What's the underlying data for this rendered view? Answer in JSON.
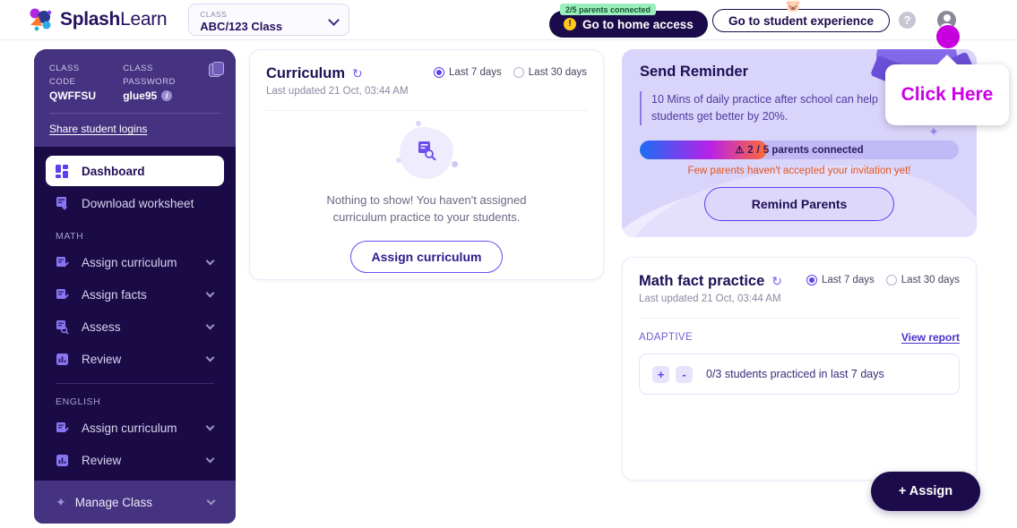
{
  "header": {
    "brand_bold": "Splash",
    "brand_light": "Learn",
    "class_selector": {
      "label": "CLASS",
      "value": "ABC/123 Class",
      "chevron_icon": "chevron-down-icon"
    },
    "parents_badge": "2/5 parents connected",
    "home_access_button": "Go to home access",
    "warning_icon": "!",
    "student_experience_button": "Go to student experience",
    "pig_icon": "🐷",
    "help_icon": "?",
    "avatar_icon": "user-avatar"
  },
  "sidebar": {
    "class_code_label": "CLASS CODE",
    "class_code_value": "QWFFSU",
    "class_password_label": "CLASS PASSWORD",
    "class_password_value": "glue95",
    "info_icon": "i",
    "copy_icon": "copy-icon",
    "share_link": "Share student logins",
    "primary_items": [
      {
        "label": "Dashboard",
        "icon": "dashboard-icon",
        "active": true
      },
      {
        "label": "Download worksheet",
        "icon": "download-worksheet-icon",
        "active": false
      }
    ],
    "math_label": "MATH",
    "math_items": [
      {
        "label": "Assign curriculum",
        "icon": "assign-icon"
      },
      {
        "label": "Assign facts",
        "icon": "assign-icon"
      },
      {
        "label": "Assess",
        "icon": "assess-icon"
      },
      {
        "label": "Review",
        "icon": "review-icon"
      }
    ],
    "english_label": "ENGLISH",
    "english_items": [
      {
        "label": "Assign curriculum",
        "icon": "assign-icon"
      },
      {
        "label": "Review",
        "icon": "review-icon"
      }
    ],
    "manage_class": "Manage Class",
    "manage_class_icon": "gear-icon"
  },
  "curriculum": {
    "title": "Curriculum",
    "refresh_icon": "refresh-icon",
    "last_updated": "Last updated 21 Oct, 03:44 AM",
    "range_options": [
      {
        "label": "Last 7 days",
        "selected": true
      },
      {
        "label": "Last 30 days",
        "selected": false
      }
    ],
    "empty_icon": "document-search-icon",
    "empty_line1": "Nothing to show! You haven't assigned",
    "empty_line2": "curriculum practice to your students.",
    "assign_button": "Assign curriculum"
  },
  "reminder": {
    "title": "Send Reminder",
    "quote_line1": "10 Mins of daily practice after school can help",
    "quote_line2": "students get better by 20%.",
    "warning_icon": "⚠",
    "progress_connected": "2",
    "progress_separator": "/",
    "progress_total_text": "5 parents connected",
    "progress_percent": 40,
    "warning_text": "Few parents haven't accepted your invitation yet!",
    "remind_button": "Remind Parents",
    "sparkle_icon": "sparkle-icon"
  },
  "math_fact": {
    "title": "Math fact practice",
    "refresh_icon": "refresh-icon",
    "last_updated": "Last updated 21 Oct, 03:44 AM",
    "range_options": [
      {
        "label": "Last 7 days",
        "selected": true
      },
      {
        "label": "Last 30 days",
        "selected": false
      }
    ],
    "adaptive_label": "ADAPTIVE",
    "view_report": "View report",
    "plus_badge": "+",
    "minus_badge": "-",
    "practice_text": "0/3 students practiced in last 7 days"
  },
  "assign_fab": "+ Assign",
  "tooltip": {
    "text": "Click Here",
    "cursor_icon": "cursor-dot"
  },
  "colors": {
    "brand_navy": "#1c0b4a",
    "sidebar": "#1a0b47",
    "sidebar_top": "#453280",
    "accent_purple": "#5b3ff0",
    "reminder_bg": "#d9d4fa",
    "badge_green": "#99eebc",
    "warn_orange": "#e4541e",
    "tooltip_magenta": "#cc00e6"
  }
}
